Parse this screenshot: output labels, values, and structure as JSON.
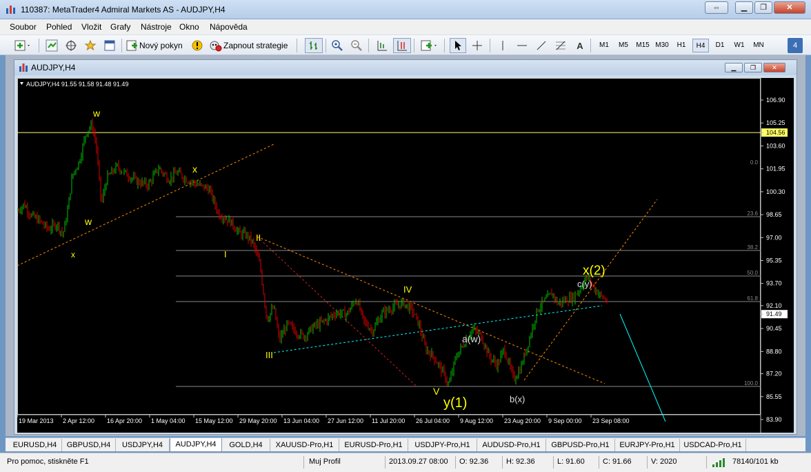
{
  "window": {
    "title": "110387: MetaTrader4 Admiral Markets AS - AUDJPY,H4"
  },
  "menu": [
    "Soubor",
    "Pohled",
    "Vložit",
    "Grafy",
    "Nástroje",
    "Okno",
    "Nápověda"
  ],
  "toolbar": {
    "new_order_label": "Nový pokyn",
    "autotrading_label": "Zapnout strategie",
    "timeframes": [
      "M1",
      "M5",
      "M15",
      "M30",
      "H1",
      "H4",
      "D1",
      "W1",
      "MN"
    ],
    "active_timeframe": "H4",
    "badge": "4"
  },
  "chart_window": {
    "title": "AUDJPY,H4"
  },
  "chart": {
    "info_line": "AUDJPY,H4  91.55 91.58 91.48 91.49",
    "price_axis": [
      "106.90",
      "105.25",
      "104.56",
      "103.60",
      "101.95",
      "100.30",
      "98.65",
      "97.00",
      "95.35",
      "93.70",
      "92.10",
      "91.49",
      "90.45",
      "88.80",
      "87.20",
      "85.55",
      "83.90"
    ],
    "time_axis": [
      "19 Mar 2013",
      "2 Apr 12:00",
      "16 Apr 20:00",
      "1 May 04:00",
      "15 May 12:00",
      "29 May 20:00",
      "13 Jun 04:00",
      "27 Jun 12:00",
      "11 Jul 20:00",
      "26 Jul 04:00",
      "9 Aug 12:00",
      "23 Aug 20:00",
      "9 Sep 00:00",
      "23 Sep 08:00"
    ],
    "fib_levels": [
      "0.0",
      "23.6",
      "38.2",
      "50.0",
      "61.8",
      "100.0"
    ],
    "wave_labels": [
      "w",
      "x",
      "w",
      "x",
      "I",
      "II",
      "III",
      "IV",
      "V",
      "y(1)",
      "a(w)",
      "b(x)",
      "c(y)",
      "x(2)"
    ],
    "horizontal_line_price": "104.56",
    "current_price": "91.49",
    "colors": {
      "background": "#000000",
      "bull_candle": "#00c000",
      "bear_candle": "#e00000",
      "labels": "#ffff00",
      "trendline_orange": "#ff8c00",
      "trendline_cyan": "#00ffff"
    }
  },
  "symbol_tabs": [
    "EURUSD,H4",
    "GBPUSD,H4",
    "USDJPY,H4",
    "AUDJPY,H4",
    "GOLD,H4",
    "XAUUSD-Pro,H1",
    "EURUSD-Pro,H1",
    "USDJPY-Pro,H1",
    "AUDUSD-Pro,H1",
    "GBPUSD-Pro,H1",
    "EURJPY-Pro,H1",
    "USDCAD-Pro,H1"
  ],
  "active_tab": "AUDJPY,H4",
  "status": {
    "help": "Pro pomoc, stiskněte F1",
    "profile": "Muj Profil",
    "datetime": "2013.09.27 08:00",
    "open": "O: 92.36",
    "high": "H: 92.36",
    "low": "L: 91.60",
    "close": "C: 91.66",
    "volume": "V: 2020",
    "traffic": "78140/101 kb"
  }
}
